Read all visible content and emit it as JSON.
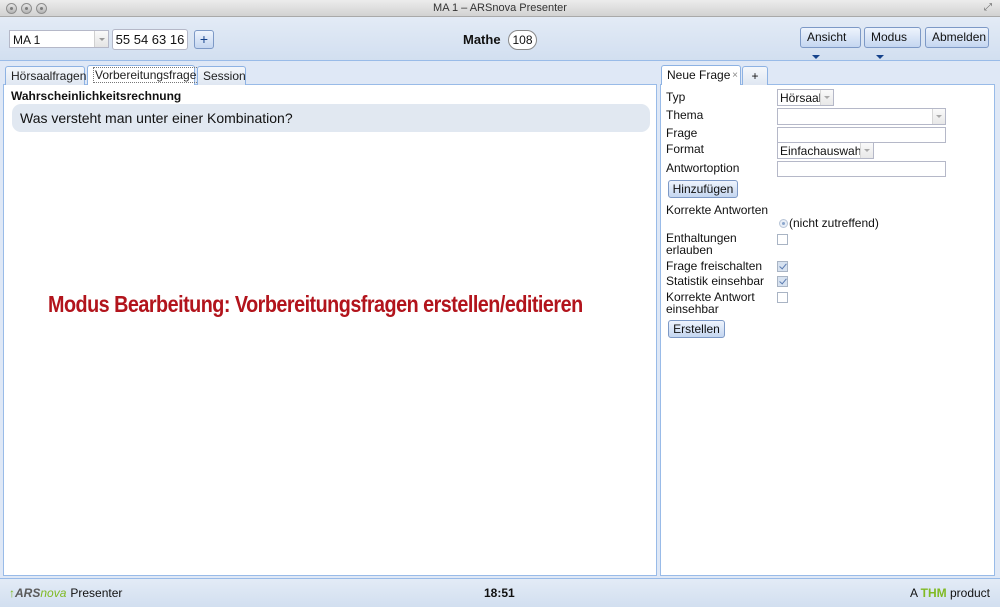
{
  "window": {
    "title": "MA 1 – ARSnova Presenter"
  },
  "toolbar": {
    "session_select": "MA 1",
    "session_code": "55 54 63 16",
    "add_label": "+",
    "course_name": "Mathe",
    "participant_count": "108",
    "view_label": "Ansicht",
    "mode_label": "Modus",
    "logout_label": "Abmelden"
  },
  "left": {
    "tabs": [
      {
        "label": "Hörsaalfragen",
        "active": false
      },
      {
        "label": "Vorbereitungsfragen",
        "active": true
      },
      {
        "label": "Session",
        "active": false
      }
    ],
    "category_title": "Wahrscheinlichkeitsrechnung",
    "question": "Was versteht man unter einer Kombination?",
    "annotation": "Modus Bearbeitung: Vorbereitungsfragen erstellen/editieren"
  },
  "right": {
    "tabs": [
      {
        "label": "Neue Frage",
        "close": "×"
      },
      {
        "label": "+"
      }
    ],
    "form": {
      "type_label": "Typ",
      "type_value": "Hörsaal",
      "topic_label": "Thema",
      "topic_value": "",
      "question_label": "Frage",
      "format_label": "Format",
      "format_value": "Einfachauswahl",
      "answer_option_label": "Antwortoption",
      "add_button": "Hinzufügen",
      "correct_answers_label": "Korrekte Antworten",
      "correct_answers_value": "(nicht zutreffend)",
      "abstentions_label_1": "Enthaltungen",
      "abstentions_label_2": "erlauben",
      "abstentions_checked": false,
      "release_label": "Frage freischalten",
      "release_checked": true,
      "stats_label": "Statistik einsehbar",
      "stats_checked": true,
      "correct_visible_label_1": "Korrekte Antwort",
      "correct_visible_label_2": "einsehbar",
      "correct_visible_checked": false,
      "create_button": "Erstellen"
    }
  },
  "status": {
    "logo_ars": "ARS",
    "logo_nova": "nova",
    "logo_presenter": "Presenter",
    "clock": "18:51",
    "footer_prefix": "A",
    "footer_brand": "THM",
    "footer_suffix": "product"
  },
  "colors": {
    "accent": "#99bbe8",
    "annotation": "#b2141c",
    "brand_green": "#80ba24"
  }
}
